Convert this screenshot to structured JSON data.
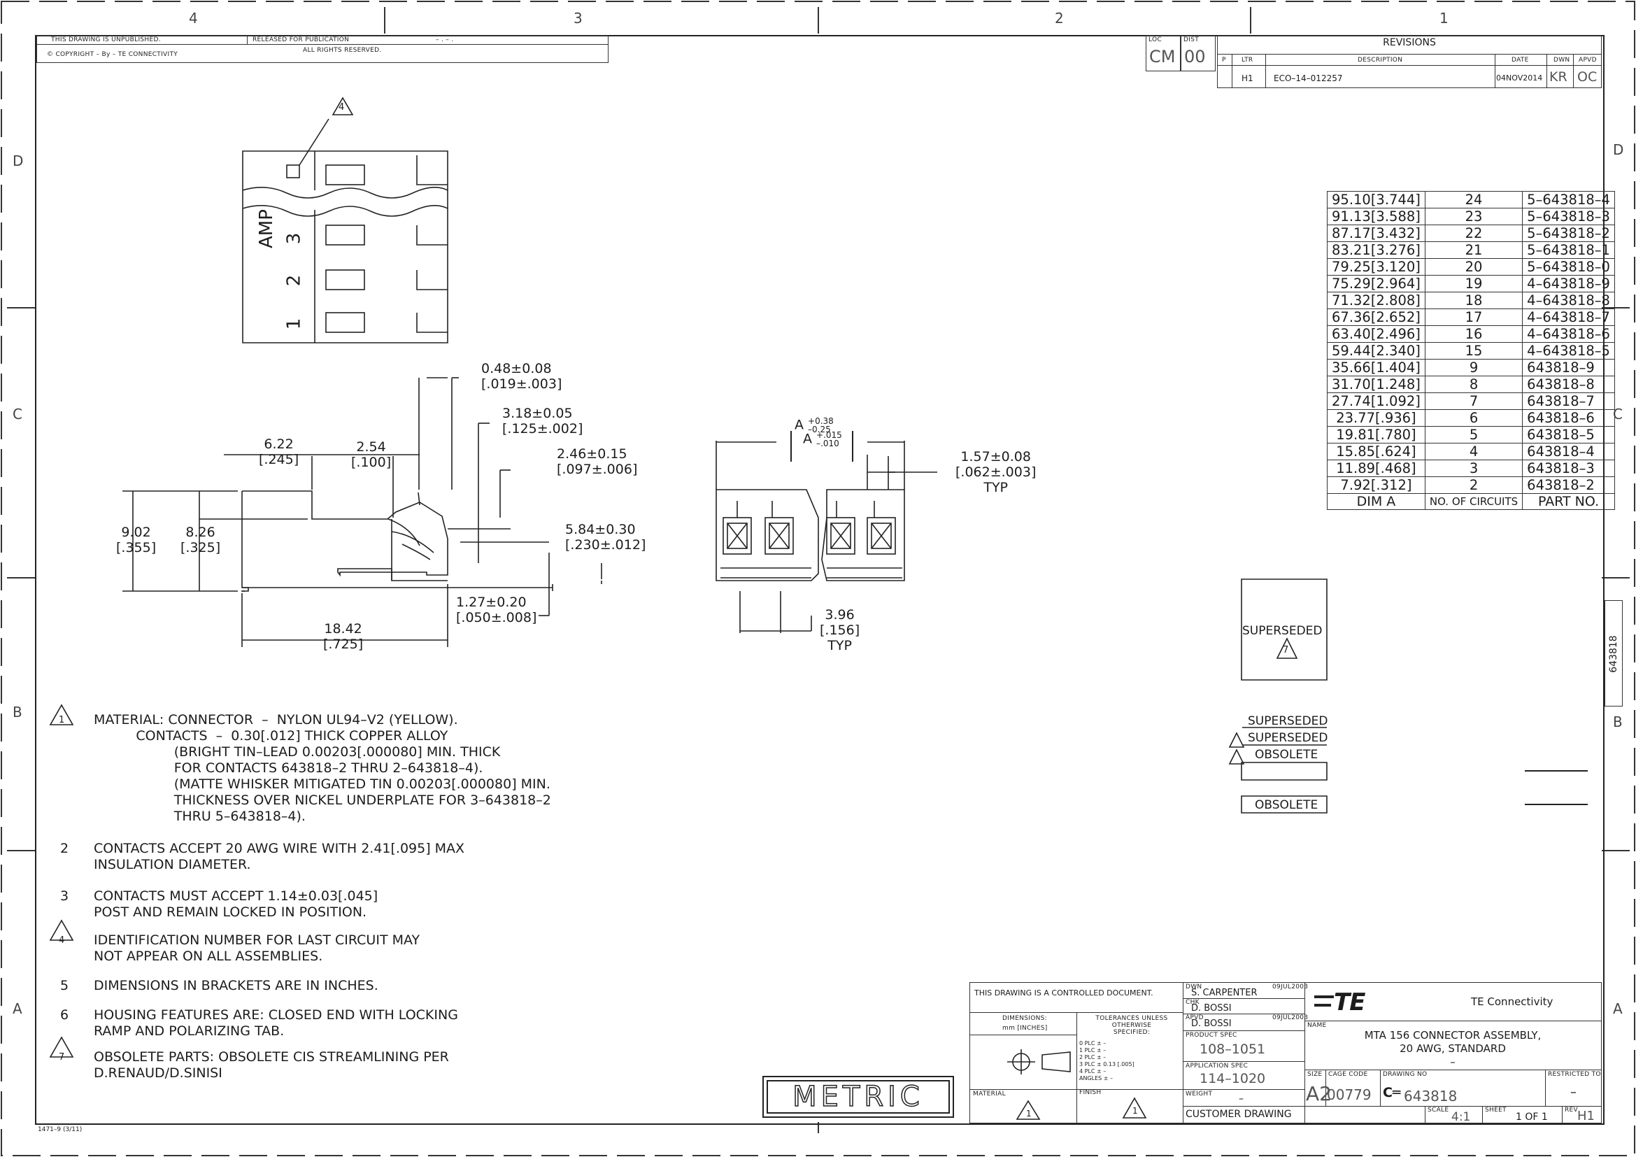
{
  "zones": {
    "top": [
      "4",
      "3",
      "2",
      "1"
    ],
    "side_left": [
      "D",
      "C",
      "B",
      "A"
    ],
    "side_right": [
      "D",
      "C",
      "B",
      "A"
    ]
  },
  "header": {
    "unpublished": "THIS DRAWING IS UNPUBLISHED.",
    "released": "RELEASED FOR PUBLICATION",
    "copyright": "COPYRIGHT  –   By  – TE CONNECTIVITY",
    "rights": "ALL RIGHTS RESERVED.",
    "dash": "– . –   ."
  },
  "loc": {
    "label": "LOC",
    "value": "CM"
  },
  "dist": {
    "label": "DIST",
    "value": "00"
  },
  "revisions": {
    "title": "REVISIONS",
    "headers": [
      "P",
      "LTR",
      "DESCRIPTION",
      "DATE",
      "DWN",
      "APVD"
    ],
    "row": {
      "ltr": "H1",
      "description": "ECO–14–012257",
      "date": "04NOV2014",
      "dwn": "KR",
      "apvd": "OC"
    }
  },
  "dims": {
    "d1": "0.48±0.08",
    "d1i": "[.019±.003]",
    "d2": "3.18±0.05",
    "d2i": "[.125±.002]",
    "d3": "2.46±0.15",
    "d3i": "[.097±.006]",
    "d4": "6.22",
    "d4i": "[.245]",
    "d5": "2.54",
    "d5i": "[.100]",
    "d6": "9.02",
    "d6i": "[.355]",
    "d7": "8.26",
    "d7i": "[.325]",
    "d8": "5.84±0.30",
    "d8i": "[.230±.012]",
    "d9": "1.27±0.20",
    "d9i": "[.050±.008]",
    "d10": "18.42",
    "d10i": "[.725]",
    "a_label": "A",
    "a_tol": "+0.38",
    "a_tol2": "–0.25",
    "a_in": "A",
    "a_in_tol": "+.015",
    "a_in_tol2": "–.010",
    "d11": "1.57±0.08",
    "d11i": "[.062±.003]",
    "d11t": "TYP",
    "d12": "3.96",
    "d12i": "[.156]",
    "d12t": "TYP",
    "amp": "AMP",
    "pin1": "1",
    "pin2": "2",
    "pin3": "3",
    "flag": "4"
  },
  "dim_table": {
    "rows": [
      [
        "95.10[3.744]",
        "24",
        "5–643818–4"
      ],
      [
        "91.13[3.588]",
        "23",
        "5–643818–3"
      ],
      [
        "87.17[3.432]",
        "22",
        "5–643818–2"
      ],
      [
        "83.21[3.276]",
        "21",
        "5–643818–1"
      ],
      [
        "79.25[3.120]",
        "20",
        "5–643818–0"
      ],
      [
        "75.29[2.964]",
        "19",
        "4–643818–9"
      ],
      [
        "71.32[2.808]",
        "18",
        "4–643818–8"
      ],
      [
        "67.36[2.652]",
        "17",
        "4–643818–7"
      ],
      [
        "63.40[2.496]",
        "16",
        "4–643818–6"
      ],
      [
        "59.44[2.340]",
        "15",
        "4–643818–5"
      ],
      [
        "35.66[1.404]",
        "9",
        "643818–9"
      ],
      [
        "31.70[1.248]",
        "8",
        "643818–8"
      ],
      [
        "27.74[1.092]",
        "7",
        "643818–7"
      ],
      [
        "23.77[.936]",
        "6",
        "643818–6"
      ],
      [
        "19.81[.780]",
        "5",
        "643818–5"
      ],
      [
        "15.85[.624]",
        "4",
        "643818–4"
      ],
      [
        "11.89[.468]",
        "3",
        "643818–3"
      ],
      [
        "7.92[.312]",
        "2",
        "643818–2"
      ]
    ],
    "footer": [
      "DIM A",
      "NO. OF CIRCUITS",
      "PART NO."
    ]
  },
  "status": {
    "superseded": "SUPERSEDED",
    "obsolete": "OBSOLETE",
    "flag7": "7"
  },
  "notes": [
    {
      "num": "1",
      "flag": true,
      "text": "MATERIAL: CONNECTOR  –  NYLON UL94–V2 (YELLOW).\n          CONTACTS  –  0.30[.012] THICK COPPER ALLOY\n                   (BRIGHT TIN–LEAD 0.00203[.000080] MIN. THICK\n                   FOR CONTACTS 643818–2 THRU 2–643818–4).\n                   (MATTE WHISKER MITIGATED TIN 0.00203[.000080] MIN.\n                   THICKNESS OVER NICKEL UNDERPLATE FOR 3–643818–2\n                   THRU 5–643818–4)."
    },
    {
      "num": "2",
      "flag": false,
      "text": "CONTACTS ACCEPT 20 AWG WIRE WITH 2.41[.095] MAX\nINSULATION DIAMETER."
    },
    {
      "num": "3",
      "flag": false,
      "text": "CONTACTS MUST ACCEPT 1.14±0.03[.045]\nPOST AND REMAIN LOCKED IN POSITION."
    },
    {
      "num": "4",
      "flag": true,
      "text": "IDENTIFICATION NUMBER FOR LAST CIRCUIT MAY\nNOT APPEAR ON ALL ASSEMBLIES."
    },
    {
      "num": "5",
      "flag": false,
      "text": "DIMENSIONS IN BRACKETS ARE IN INCHES."
    },
    {
      "num": "6",
      "flag": false,
      "text": "HOUSING FEATURES ARE: CLOSED END WITH LOCKING\nRAMP AND POLARIZING TAB."
    },
    {
      "num": "7",
      "flag": true,
      "text": "OBSOLETE PARTS: OBSOLETE CIS STREAMLINING PER\nD.RENAUD/D.SINISI"
    }
  ],
  "metric": "METRIC",
  "title_block": {
    "controlled": "THIS DRAWING IS A CONTROLLED DOCUMENT.",
    "dimensions_label": "DIMENSIONS:",
    "dimensions_units": "mm [INCHES]",
    "tolerances": "TOLERANCES UNLESS OTHERWISE SPECIFIED:",
    "tol_rows": [
      "0 PLC   ± –",
      "1 PLC   ± –",
      "2 PLC   ± –",
      "3 PLC   ± 0.13 [.005]",
      "4 PLC   ± –",
      "ANGLES   ± –"
    ],
    "material_label": "MATERIAL",
    "finish_label": "FINISH",
    "dwn_label": "DWN",
    "dwn_name": "S. CARPENTER",
    "dwn_date": "09JUL2003",
    "chk_label": "CHK",
    "chk_name": "D. BOSSI",
    "apvd_label": "APVD",
    "apvd_name": "D. BOSSI",
    "apvd_date": "09JUL2003",
    "product_spec_label": "PRODUCT SPEC",
    "product_spec": "108–1051",
    "app_spec_label": "APPLICATION SPEC",
    "app_spec": "114–1020",
    "weight_label": "WEIGHT",
    "weight": "–",
    "customer": "CUSTOMER DRAWING",
    "company": "TE Connectivity",
    "logo": "TE",
    "name_label": "NAME",
    "name1": "MTA 156 CONNECTOR ASSEMBLY,",
    "name2": "20 AWG, STANDARD",
    "name3": "–",
    "size_label": "SIZE",
    "size": "A2",
    "cage_label": "CAGE CODE",
    "cage": "00779",
    "dwg_label": "DRAWING NO",
    "dwg": "643818",
    "restricted_label": "RESTRICTED TO",
    "restricted": "–",
    "scale_label": "SCALE",
    "scale": "4:1",
    "sheet_label": "SHEET",
    "sheet": "1 OF 1",
    "rev_label": "REV",
    "rev": "H1"
  },
  "side_tab": "643818",
  "form_id": "1471–9  (3/11)"
}
